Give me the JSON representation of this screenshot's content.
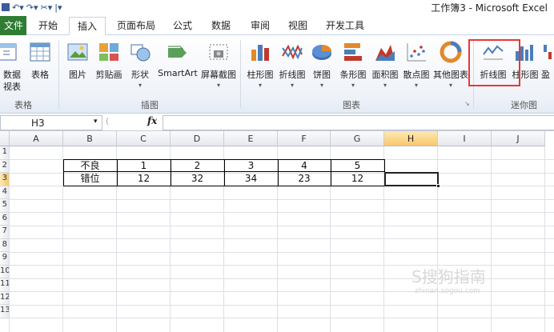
{
  "window": {
    "title": "工作簿3 - Microsoft Excel"
  },
  "tabs": [
    "文件",
    "开始",
    "插入",
    "页面布局",
    "公式",
    "数据",
    "审阅",
    "视图",
    "开发工具"
  ],
  "ribbon": {
    "buttons": {
      "pivot": [
        "数据",
        "视表"
      ],
      "table": "表格",
      "picture": "图片",
      "clipart": "剪贴画",
      "shapes": "形状",
      "smartart": "SmartArt",
      "screenshot": "屏幕截图",
      "column": "柱形图",
      "line": "折线图",
      "pie": "饼图",
      "bar": "条形图",
      "area": "面积图",
      "scatter": "散点图",
      "other": "其他图表",
      "sparkline_line": "折线图",
      "sparkline_column": "柱形图",
      "sparkline_winloss": "盈"
    },
    "groups": {
      "tables": "表格",
      "illustrations": "插图",
      "charts": "图表",
      "sparklines": "迷你图"
    }
  },
  "formula_bar": {
    "name_box": "H3",
    "fx": "fx",
    "value": ""
  },
  "grid": {
    "columns": [
      "A",
      "B",
      "C",
      "D",
      "E",
      "F",
      "G",
      "H",
      "I",
      "J"
    ],
    "selected_column": "H",
    "rows": [
      "1",
      "2",
      "3",
      "4",
      "5",
      "6",
      "7",
      "8",
      "9",
      "10",
      "11",
      "12",
      "13"
    ],
    "selected_row": "3",
    "table": [
      [
        "不良",
        "1",
        "2",
        "3",
        "4",
        "5"
      ],
      [
        "错位",
        "12",
        "32",
        "34",
        "23",
        "12"
      ]
    ]
  },
  "watermark": {
    "text": "S搜狗指南",
    "sub": "zhinan.sogou.com"
  },
  "colors": {
    "file_tab": "#2e7d32",
    "highlight": "#e53935",
    "selection": "#f8c86a"
  }
}
